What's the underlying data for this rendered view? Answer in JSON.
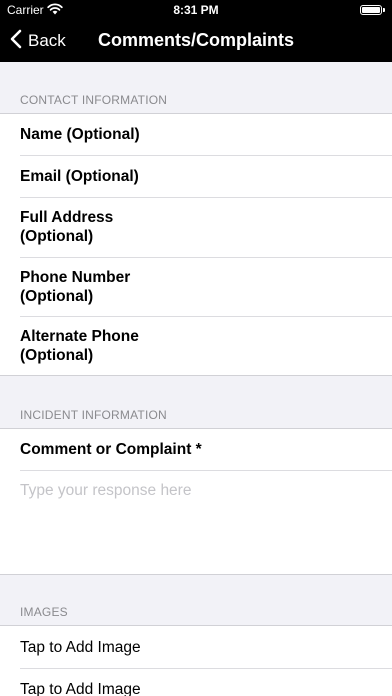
{
  "status_bar": {
    "carrier": "Carrier",
    "time": "8:31 PM",
    "battery_level": 1.0
  },
  "nav": {
    "back_label": "Back",
    "title": "Comments/Complaints",
    "back_icon": "chevron-left-icon"
  },
  "contact": {
    "header": "CONTACT INFORMATION",
    "fields": [
      "Name (Optional)",
      "Email (Optional)",
      "Full Address\n(Optional)",
      "Phone Number\n(Optional)",
      "Alternate Phone\n(Optional)"
    ]
  },
  "incident": {
    "header": "INCIDENT INFORMATION",
    "comment_label": "Comment or Complaint *",
    "comment_value": "",
    "comment_placeholder": "Type your response here"
  },
  "images": {
    "header": "IMAGES",
    "items": [
      "Tap to Add Image",
      "Tap to Add Image"
    ]
  },
  "colors": {
    "bar_background": "#000000",
    "page_background": "#f2f2f7",
    "section_header": "#8a8a8e",
    "placeholder": "#c4c4c8"
  }
}
